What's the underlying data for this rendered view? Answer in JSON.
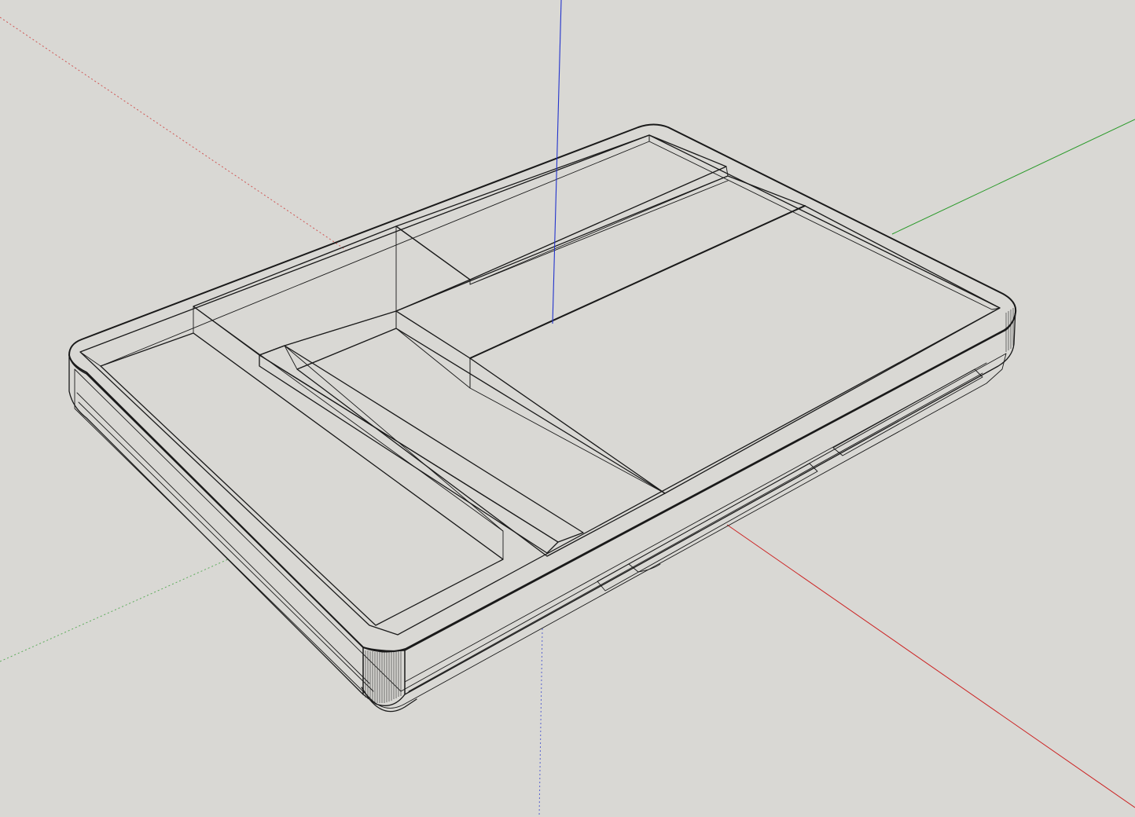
{
  "viewport": {
    "background_color": "#d9d8d4",
    "model_face_color": "#d8d8d8",
    "model_face_light_color": "#efefef",
    "model_face_side_color": "#c8c8c8",
    "edge_color": "#1a1a1a"
  },
  "axes": {
    "red_color": "#cc2222",
    "green_color": "#2a9a2a",
    "blue_color": "#2233cc"
  },
  "model": {
    "type": "tray-with-compartments",
    "compartments": [
      "left-long-compartment",
      "middle-compartment",
      "top-left-small-compartment",
      "top-right-compartment",
      "large-right-platform"
    ]
  }
}
